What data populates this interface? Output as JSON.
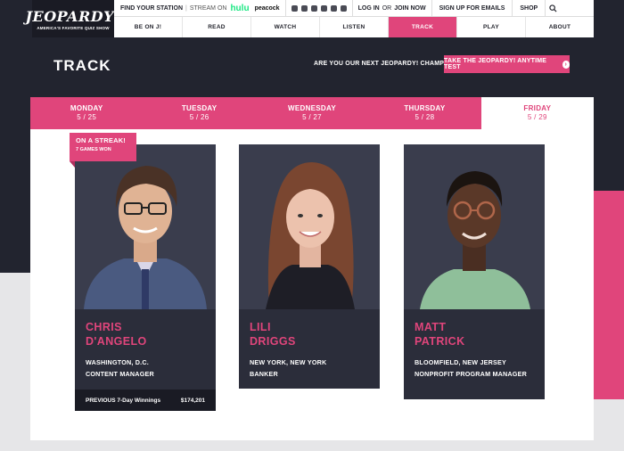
{
  "logo": {
    "word": "JEOPARDY!",
    "tagline": "AMERICA'S FAVORITE QUIZ SHOW"
  },
  "header": {
    "find_station": "FIND YOUR STATION",
    "stream_on": "STREAM ON",
    "hulu": "hulu",
    "peacock": "peacock",
    "login": "LOG IN",
    "or": "OR",
    "join": "JOIN NOW",
    "signup": "SIGN UP FOR EMAILS",
    "shop": "SHOP"
  },
  "nav": [
    {
      "label": "BE ON J!"
    },
    {
      "label": "READ"
    },
    {
      "label": "WATCH"
    },
    {
      "label": "LISTEN"
    },
    {
      "label": "TRACK"
    },
    {
      "label": "PLAY"
    },
    {
      "label": "ABOUT"
    }
  ],
  "page": {
    "title": "TRACK",
    "cta_text": "ARE YOU OUR NEXT JEOPARDY! CHAMPION?",
    "cta_button": "TAKE THE JEOPARDY! ANYTIME TEST"
  },
  "days": [
    {
      "day": "MONDAY",
      "date": "5 / 25"
    },
    {
      "day": "TUESDAY",
      "date": "5 / 26"
    },
    {
      "day": "WEDNESDAY",
      "date": "5 / 27"
    },
    {
      "day": "THURSDAY",
      "date": "5 / 28"
    },
    {
      "day": "FRIDAY",
      "date": "5 / 29"
    }
  ],
  "streak": {
    "title": "ON A STREAK!",
    "games": "7 GAMES WON"
  },
  "contestants": [
    {
      "first": "CHRIS",
      "last": "D'ANGELO",
      "location": "WASHINGTON, D.C.",
      "occupation": "CONTENT MANAGER",
      "winnings_label": "PREVIOUS 7-Day Winnings",
      "winnings_value": "$174,201"
    },
    {
      "first": "LILI",
      "last": "DRIGGS",
      "location": "NEW YORK, NEW YORK",
      "occupation": "BANKER"
    },
    {
      "first": "MATT",
      "last": "PATRICK",
      "location": "BLOOMFIELD, NEW JERSEY",
      "occupation": "NONPROFIT PROGRAM MANAGER"
    }
  ],
  "colors": {
    "accent": "#e0457b",
    "dark": "#22242f",
    "card": "#2b2d3a"
  }
}
